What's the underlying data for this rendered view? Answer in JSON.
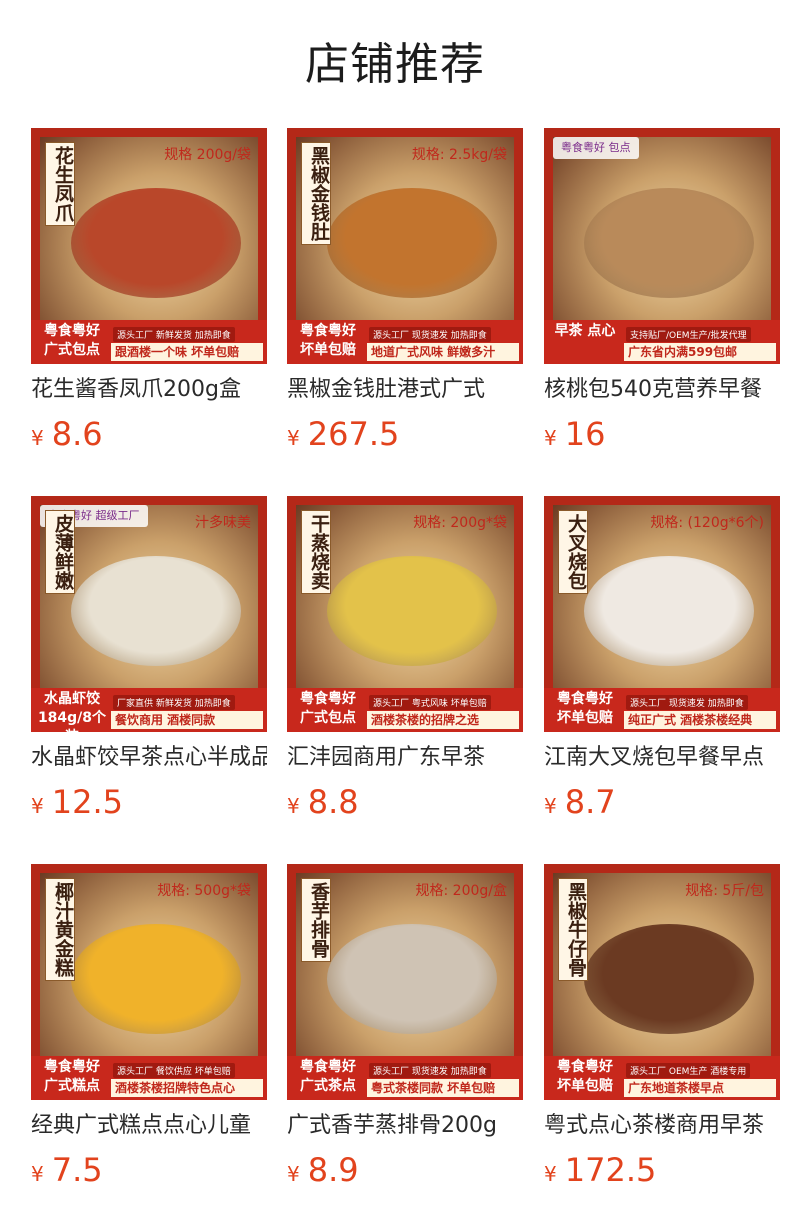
{
  "section": {
    "title": "店铺推荐"
  },
  "currency_symbol": "¥",
  "products": [
    {
      "name": "花生酱香凤爪200g盒",
      "price": "8.6",
      "image": {
        "vlabel": "花生凤爪",
        "spec": "规格 200g/袋",
        "brand": "粤食粤好 广式包点",
        "tagline": "源头工厂 新鲜发货 加热即食",
        "slogan": "跟酒楼一个味 坏单包赔",
        "photo_color": "#b9472a"
      }
    },
    {
      "name": "黑椒金钱肚港式广式",
      "price": "267.5",
      "image": {
        "vlabel": "黑椒金钱肚",
        "spec": "规格: 2.5kg/袋",
        "brand": "粤食粤好 坏单包赔",
        "tagline": "源头工厂 现货速发 加热即食",
        "slogan": "地道广式风味 鲜嫩多汁",
        "photo_color": "#c2742e"
      }
    },
    {
      "name": "核桃包540克营养早餐",
      "price": "16",
      "image": {
        "vlabel": "",
        "spec": "",
        "brand": "早茶 点心",
        "tagline": "支持贴厂/OEM生产/批发代理",
        "slogan": "广东省内满599包邮",
        "photo_color": "#b98a5a",
        "topbadge": "粤食粤好 包点"
      }
    },
    {
      "name": "水晶虾饺早茶点心半成品",
      "price": "12.5",
      "image": {
        "vlabel": "皮薄鲜嫩",
        "spec": "汁多味美",
        "brand": "水晶虾饺184g/8个装",
        "tagline": "厂家直供 新鲜发货 加热即食",
        "slogan": "餐饮商用 酒楼同款",
        "photo_color": "#e8e1d2",
        "topbadge": "粤食粤好 超级工厂"
      }
    },
    {
      "name": "汇沣园商用广东早茶",
      "price": "8.8",
      "image": {
        "vlabel": "干蒸烧卖",
        "spec": "规格: 200g*袋",
        "brand": "粤食粤好 广式包点",
        "tagline": "源头工厂 粤式风味 坏单包赔",
        "slogan": "酒楼茶楼的招牌之选",
        "photo_color": "#e3c24a"
      }
    },
    {
      "name": "江南大叉烧包早餐早点",
      "price": "8.7",
      "image": {
        "vlabel": "大叉烧包",
        "spec": "规格: (120g*6个)",
        "brand": "粤食粤好 坏单包赔",
        "tagline": "源头工厂 现货速发 加热即食",
        "slogan": "纯正广式 酒楼茶楼经典",
        "photo_color": "#efe9e2"
      }
    },
    {
      "name": "经典广式糕点点心儿童",
      "price": "7.5",
      "image": {
        "vlabel": "椰汁黄金糕",
        "spec": "规格: 500g*袋",
        "brand": "粤食粤好 广式糕点",
        "tagline": "源头工厂 餐饮供应 坏单包赔",
        "slogan": "酒楼茶楼招牌特色点心",
        "photo_color": "#f0b22a"
      }
    },
    {
      "name": "广式香芋蒸排骨200g",
      "price": "8.9",
      "image": {
        "vlabel": "香芋排骨",
        "spec": "规格: 200g/盒",
        "brand": "粤食粤好 广式茶点",
        "tagline": "源头工厂 现货速发 加热即食",
        "slogan": "粤式茶楼同款 坏单包赔",
        "photo_color": "#cfc3b4"
      }
    },
    {
      "name": "粤式点心茶楼商用早茶",
      "price": "172.5",
      "image": {
        "vlabel": "黑椒牛仔骨",
        "spec": "规格: 5斤/包",
        "brand": "粤食粤好 坏单包赔",
        "tagline": "源头工厂 OEM生产 酒楼专用",
        "slogan": "广东地道茶楼早点",
        "photo_color": "#6b3a22"
      }
    }
  ]
}
